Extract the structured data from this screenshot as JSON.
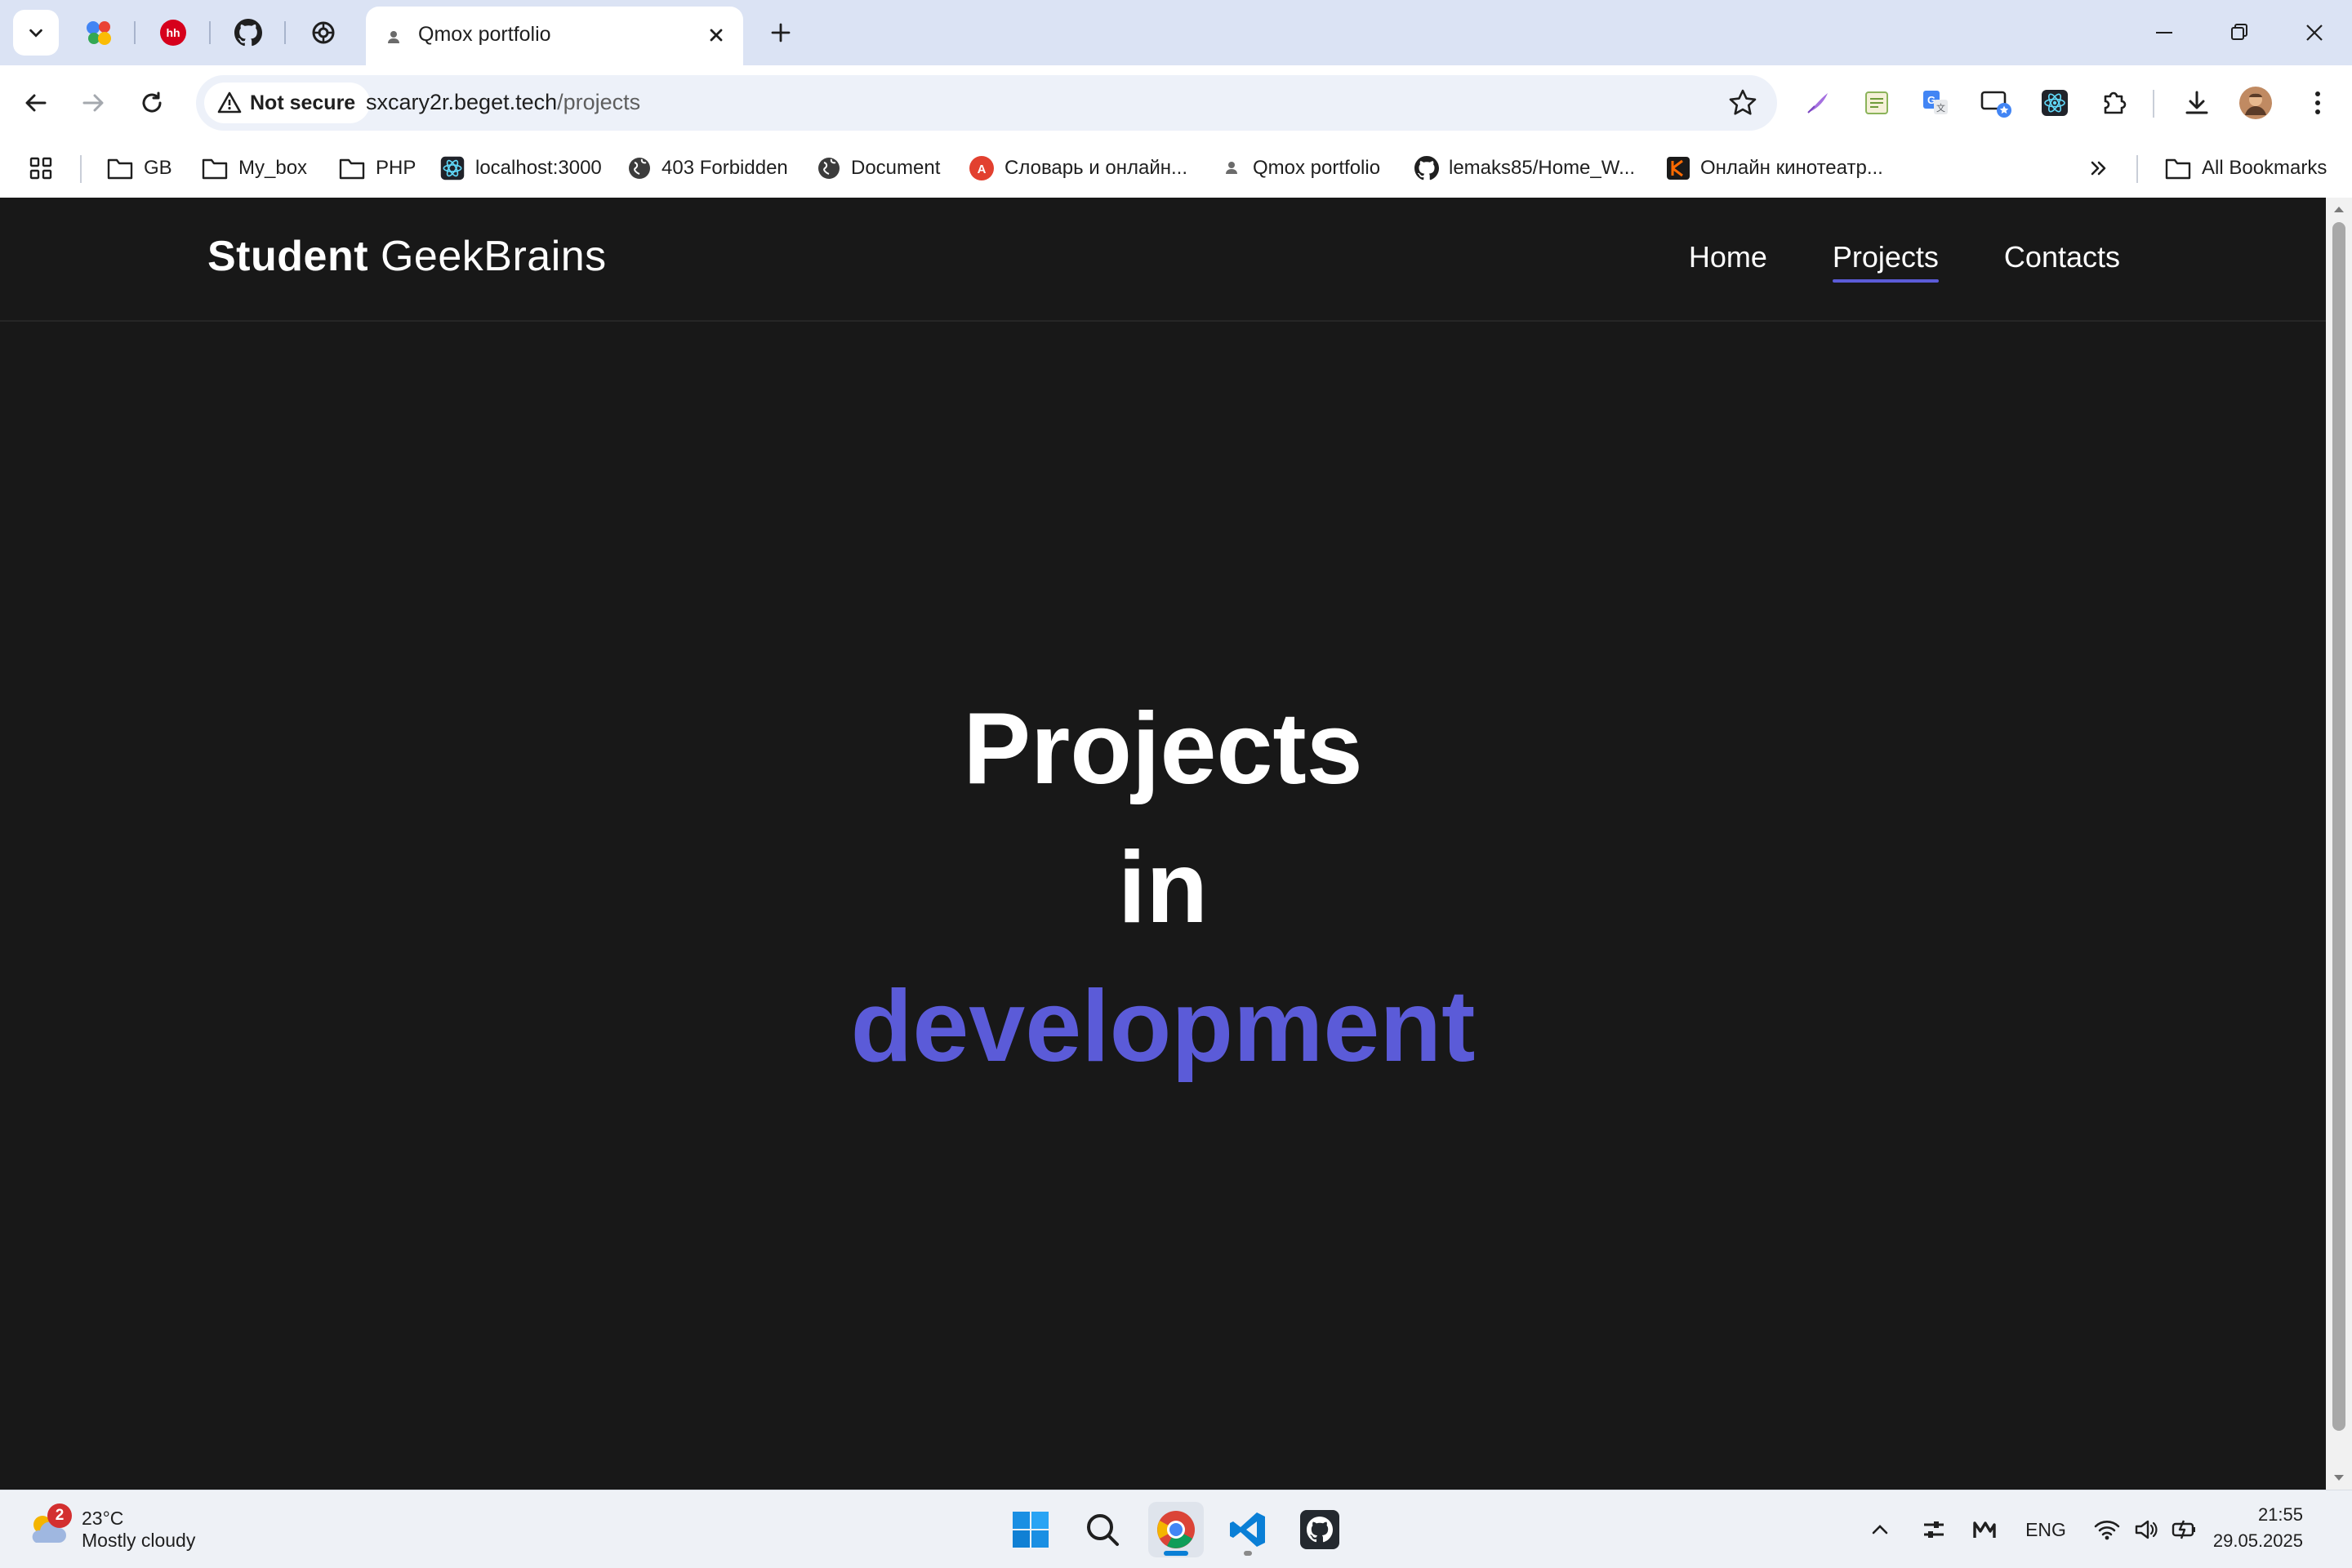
{
  "browser": {
    "active_tab": {
      "title": "Qmox portfolio"
    },
    "security_label": "Not secure",
    "url_host": "sxcary2r.beget.tech",
    "url_path": "/projects"
  },
  "bookmarks": [
    {
      "label": "GB",
      "icon": "folder-icon"
    },
    {
      "label": "My_box",
      "icon": "folder-icon"
    },
    {
      "label": "PHP",
      "icon": "folder-icon"
    },
    {
      "label": "localhost:3000",
      "icon": "react-icon"
    },
    {
      "label": "403 Forbidden",
      "icon": "globe-icon"
    },
    {
      "label": "Document",
      "icon": "globe-icon"
    },
    {
      "label": "Словарь и онлайн...",
      "icon": "translate-icon"
    },
    {
      "label": "Qmox portfolio",
      "icon": "person-icon"
    },
    {
      "label": "lemaks85/Home_W...",
      "icon": "github-icon"
    },
    {
      "label": "Онлайн кинотеатр...",
      "icon": "kinopoisk-icon"
    }
  ],
  "all_bookmarks_label": "All Bookmarks",
  "site": {
    "logo_bold": "Student",
    "logo_light": "GeekBrains",
    "nav": [
      "Home",
      "Projects",
      "Contacts"
    ],
    "active_nav": "Projects",
    "hero_line1": "Projects",
    "hero_line2": "in",
    "hero_line3": "development",
    "accent_color": "#5b5bd8"
  },
  "taskbar": {
    "weather_badge": "2",
    "temperature": "23°C",
    "condition": "Mostly cloudy",
    "language": "ENG",
    "time": "21:55",
    "date": "29.05.2025"
  }
}
